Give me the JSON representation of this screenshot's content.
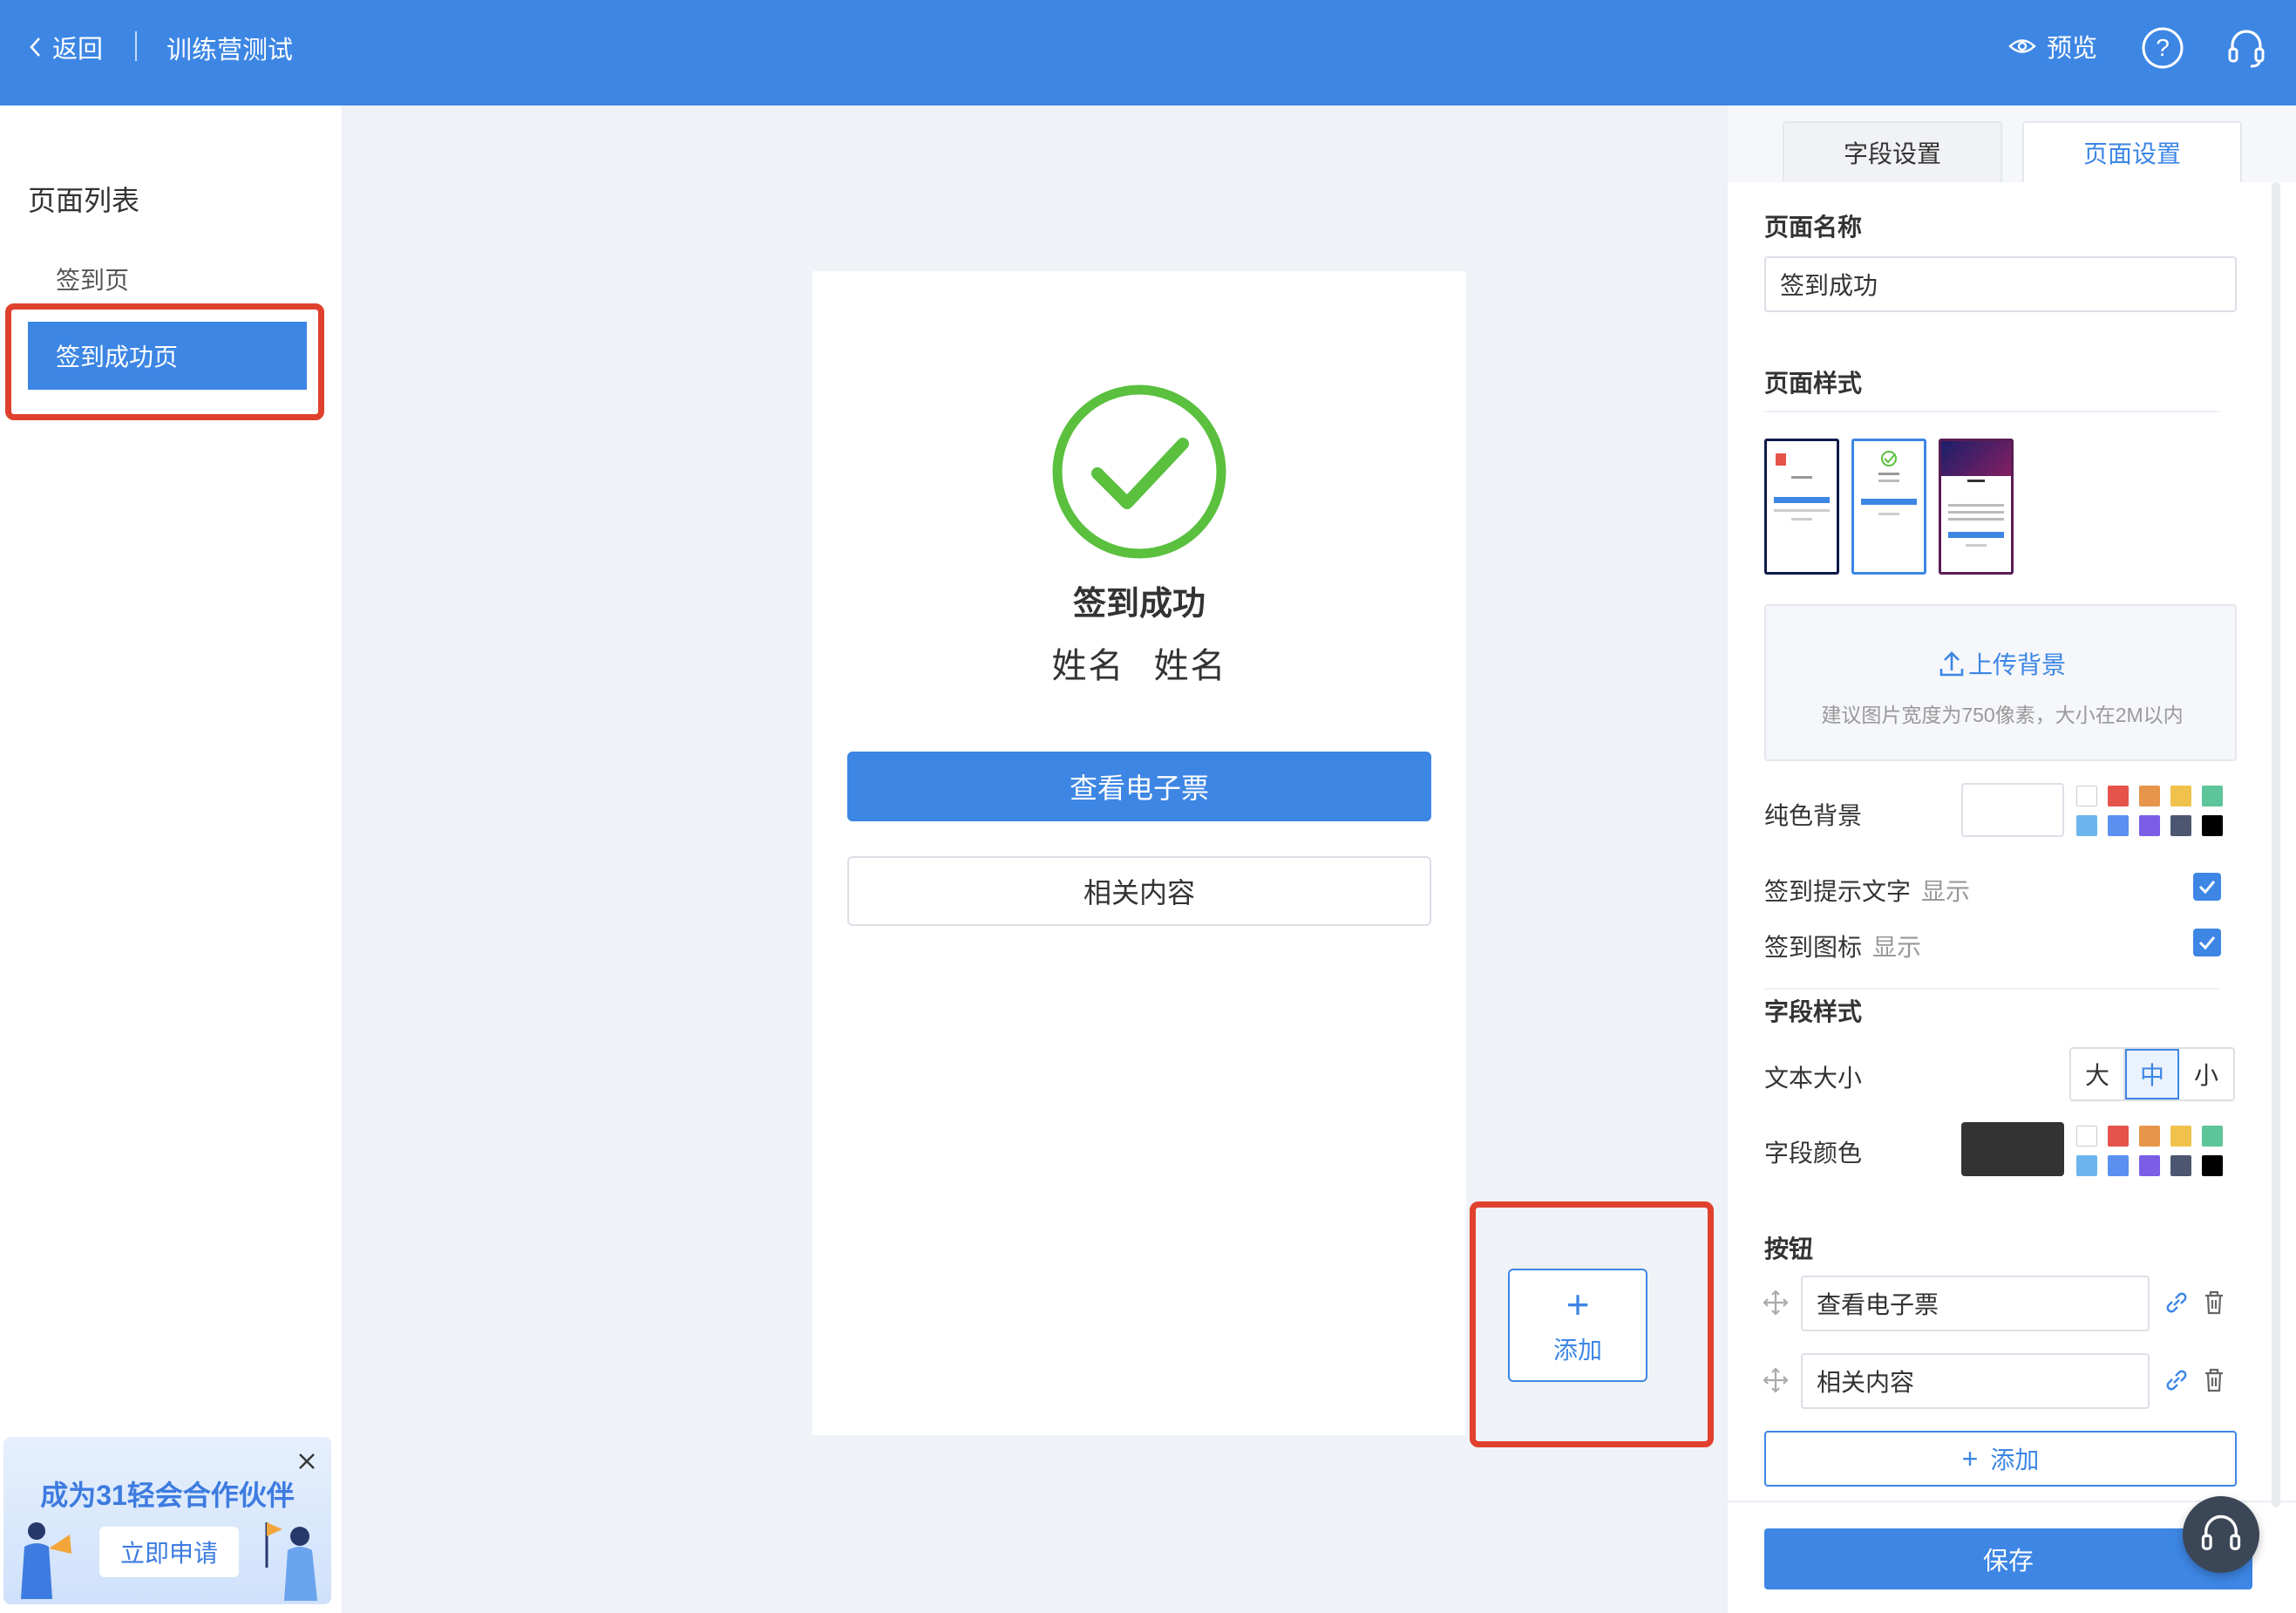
{
  "header": {
    "back_label": "返回",
    "title": "训练营测试",
    "preview_label": "预览",
    "help_icon": "question-circle-icon",
    "service_icon": "headset-icon",
    "bg_color": "#3d86e4"
  },
  "sidebar": {
    "title": "页面列表",
    "pages": [
      {
        "label": "签到页",
        "active": false
      },
      {
        "label": "签到成功页",
        "active": true
      }
    ]
  },
  "banner": {
    "title": "成为31轻会合作伙伴",
    "button_label": "立即申请"
  },
  "phone": {
    "success_title": "签到成功",
    "name_a": "姓名",
    "name_b": "姓名",
    "primary_button": "查看电子票",
    "secondary_button": "相关内容",
    "check_color": "#5ac03e"
  },
  "add_widget": {
    "label": "添加"
  },
  "right_panel": {
    "tabs": [
      {
        "label": "字段设置",
        "active": false
      },
      {
        "label": "页面设置",
        "active": true
      }
    ],
    "page_name": {
      "label": "页面名称",
      "value": "签到成功"
    },
    "page_style": {
      "label": "页面样式",
      "selected_index": 1
    },
    "upload": {
      "title": "上传背景",
      "hint": "建议图片宽度为750像素，大小在2M以内"
    },
    "solid_bg": {
      "label": "纯色背景",
      "value": "#ffffff"
    },
    "palette": [
      "#ffffff",
      "#e5534b",
      "#e6954a",
      "#f0c24b",
      "#5ec49a",
      "#6bb5ef",
      "#5b8ff0",
      "#7b5ee6",
      "#4d5670",
      "#000000"
    ],
    "toggles": [
      {
        "label": "签到提示文字",
        "state": "显示",
        "checked": true
      },
      {
        "label": "签到图标",
        "state": "显示",
        "checked": true
      }
    ],
    "field_style": {
      "label": "字段样式",
      "text_size_label": "文本大小",
      "sizes": [
        "大",
        "中",
        "小"
      ],
      "selected_size": "中",
      "color_label": "字段颜色",
      "color_value": "#333333"
    },
    "buttons": {
      "label": "按钮",
      "items": [
        "查看电子票",
        "相关内容"
      ],
      "add_label": "添加"
    },
    "save_label": "保存"
  }
}
